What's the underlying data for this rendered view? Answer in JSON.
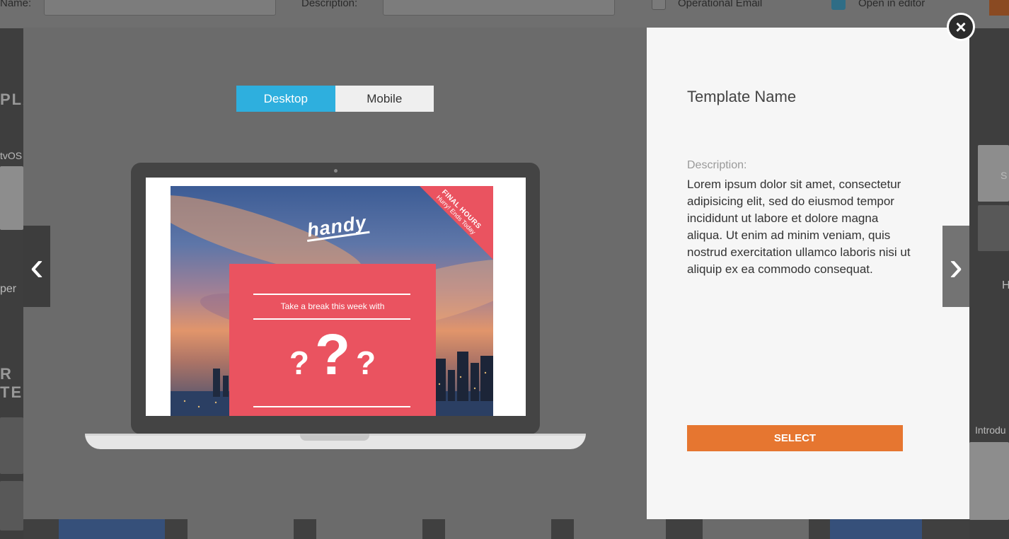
{
  "background": {
    "name_label": "Name:",
    "description_label": "Description:",
    "operational_email_label": "Operational Email",
    "open_in_editor_label": "Open in editor",
    "left_fragments": [
      "PLA",
      "tvOS",
      "per",
      "R TE"
    ],
    "right_fragments": [
      "S",
      "H",
      "Introdu"
    ]
  },
  "modal": {
    "view_toggle": {
      "desktop_label": "Desktop",
      "mobile_label": "Mobile",
      "selected": "Desktop"
    },
    "preview": {
      "brand_logo": "handy",
      "corner_banner_line1": "FINAL HOURS",
      "corner_banner_line2": "Hurry! Ends Today",
      "tagline": "Take a break this week with",
      "question_marks": [
        "?",
        "?",
        "?"
      ]
    },
    "template_name": "Template Name",
    "description_label": "Description:",
    "description_text": "Lorem ipsum dolor sit amet, consectetur adipisicing elit, sed do eiusmod tempor incididunt ut labore et dolore magna aliqua. Ut enim ad minim veniam, quis nostrud exercitation ullamco laboris nisi ut aliquip ex ea commodo consequat.",
    "select_label": "SELECT",
    "prev_arrow": "‹",
    "next_arrow": "›",
    "close_icon": "×"
  },
  "colors": {
    "toggle_active": "#2eafde",
    "select_button": "#e67630",
    "email_card": "#ea5360"
  }
}
